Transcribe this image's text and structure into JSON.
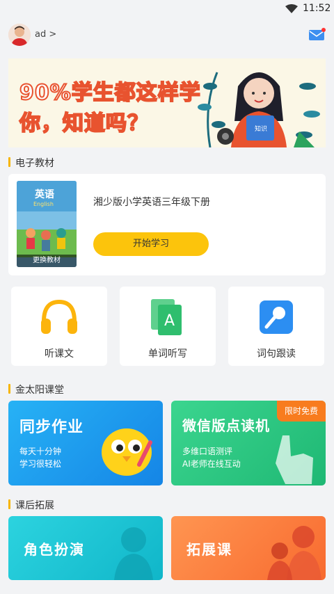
{
  "status_bar": {
    "time": "11:52",
    "wifi_icon": "wifi-icon"
  },
  "header": {
    "user_label": "ad >",
    "avatar_icon": "avatar",
    "mail_icon": "mail-icon"
  },
  "banner": {
    "line1": "90%学生都这样学",
    "line2": "你，知道吗？",
    "book_text": "知识"
  },
  "sections": {
    "ebook": "电子教材",
    "sun_class": "金太阳课堂",
    "after_class": "课后拓展"
  },
  "textbook": {
    "cover_title": "英语",
    "cover_en": "English",
    "change_label": "更换教材",
    "name": "湘少版小学英语三年级下册",
    "start_label": "开始学习"
  },
  "tools": [
    {
      "label": "听课文",
      "icon": "headphones-icon"
    },
    {
      "label": "单词听写",
      "icon": "letter-card-icon"
    },
    {
      "label": "词句跟读",
      "icon": "microphone-icon"
    }
  ],
  "class_cards": [
    {
      "title": "同步作业",
      "line1": "每天十分钟",
      "line2": "学习很轻松",
      "color": "#1aa3ee"
    },
    {
      "title": "微信版点读机",
      "line1": "多维口语测评",
      "line2": "AI老师在线互动",
      "badge": "限时免费",
      "color": "#2fcf86"
    }
  ],
  "ext_cards": [
    {
      "title": "角色扮演",
      "color": "#19c4d6"
    },
    {
      "title": "拓展课",
      "color": "#fb7e3c"
    }
  ]
}
